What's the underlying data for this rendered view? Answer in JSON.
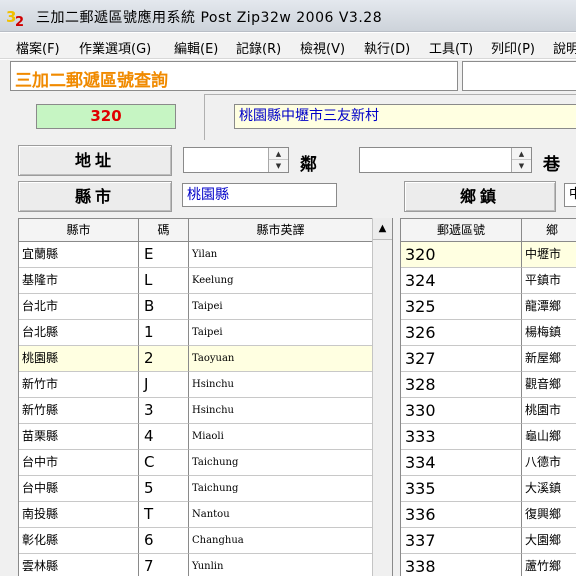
{
  "window": {
    "title": "三加二郵遞區號應用系統   Post Zip32w 2006  V3.28"
  },
  "menu": [
    "檔案(F)",
    "作業選項(G)",
    "編輯(E)",
    "記錄(R)",
    "檢視(V)",
    "執行(D)",
    "工具(T)",
    "列印(P)",
    "說明"
  ],
  "header": {
    "title": "三加二郵遞區號查詢"
  },
  "result": {
    "zip_code": "320",
    "address": "桃園縣中壢市三友新村"
  },
  "form": {
    "address_button": "地址",
    "lin_label": "鄰",
    "lane_label": "巷",
    "county_button": "縣市",
    "county_value": "桃園縣",
    "township_button": "鄉鎮",
    "right_field_value": "中"
  },
  "counties_table": {
    "columns": [
      "縣市",
      "碼",
      "縣市英譯"
    ],
    "selected_index": 4,
    "rows": [
      {
        "name": "宜蘭縣",
        "code": "E",
        "english": "Yilan"
      },
      {
        "name": "基隆市",
        "code": "L",
        "english": "Keelung"
      },
      {
        "name": "台北市",
        "code": "B",
        "english": "Taipei"
      },
      {
        "name": "台北縣",
        "code": "1",
        "english": "Taipei"
      },
      {
        "name": "桃園縣",
        "code": "2",
        "english": "Taoyuan"
      },
      {
        "name": "新竹市",
        "code": "J",
        "english": "Hsinchu"
      },
      {
        "name": "新竹縣",
        "code": "3",
        "english": "Hsinchu"
      },
      {
        "name": "苗栗縣",
        "code": "4",
        "english": "Miaoli"
      },
      {
        "name": "台中市",
        "code": "C",
        "english": "Taichung"
      },
      {
        "name": "台中縣",
        "code": "5",
        "english": "Taichung"
      },
      {
        "name": "南投縣",
        "code": "T",
        "english": "Nantou"
      },
      {
        "name": "彰化縣",
        "code": "6",
        "english": "Changhua"
      },
      {
        "name": "雲林縣",
        "code": "7",
        "english": "Yunlin"
      }
    ]
  },
  "zip_table": {
    "columns": [
      "郵遞區號",
      "鄉"
    ],
    "selected_index": 0,
    "rows": [
      {
        "zip": "320",
        "town": "中壢市"
      },
      {
        "zip": "324",
        "town": "平鎮市"
      },
      {
        "zip": "325",
        "town": "龍潭鄉"
      },
      {
        "zip": "326",
        "town": "楊梅鎮"
      },
      {
        "zip": "327",
        "town": "新屋鄉"
      },
      {
        "zip": "328",
        "town": "觀音鄉"
      },
      {
        "zip": "330",
        "town": "桃園市"
      },
      {
        "zip": "333",
        "town": "龜山鄉"
      },
      {
        "zip": "334",
        "town": "八德市"
      },
      {
        "zip": "335",
        "town": "大溪鎮"
      },
      {
        "zip": "336",
        "town": "復興鄉"
      },
      {
        "zip": "337",
        "town": "大園鄉"
      },
      {
        "zip": "338",
        "town": "蘆竹鄉"
      }
    ]
  },
  "colors": {
    "header_title": "#f08a00",
    "zip_text": "#e00000",
    "zip_bg": "#c6f5c3",
    "address_text": "#0000c8",
    "selected_row": "#ffffe1"
  }
}
